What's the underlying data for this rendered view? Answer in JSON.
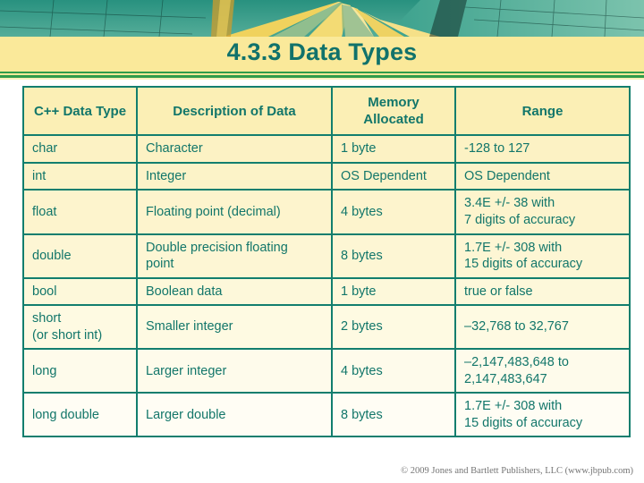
{
  "slide": {
    "title": "4.3.3 Data Types",
    "copyright": "© 2009 Jones and Bartlett Publishers, LLC (www.jbpub.com)"
  },
  "banner": {
    "name": "hot-air-balloon-photo",
    "colors": {
      "teal": "#2e9687",
      "teal_dark": "#1d7c6f",
      "teal_light": "#62b9a6",
      "yellow": "#f2d45c",
      "yellow_light": "#f7e79a",
      "gold": "#d9a22c",
      "shadow": "#13322c"
    }
  },
  "theme": {
    "title_color": "#11726b",
    "band_color": "#fae99a",
    "rule_color": "#2f9c4a",
    "table_border": "#127e6e",
    "table_text": "#12766a",
    "table_fill": "#fdf6d2"
  },
  "table": {
    "headers": [
      "C++\nData Type",
      "Description of Data",
      "Memory\nAllocated",
      "Range"
    ],
    "headers_lines": [
      [
        "C++",
        "Data Type"
      ],
      [
        "Description of Data"
      ],
      [
        "Memory",
        "Allocated"
      ],
      [
        "Range"
      ]
    ],
    "rows": [
      {
        "type": [
          "char"
        ],
        "description": [
          "Character"
        ],
        "memory": [
          "1 byte"
        ],
        "range": [
          "-128 to 127"
        ]
      },
      {
        "type": [
          "int"
        ],
        "description": [
          "Integer"
        ],
        "memory": [
          "OS Dependent"
        ],
        "range": [
          "OS Dependent"
        ]
      },
      {
        "type": [
          "float"
        ],
        "description": [
          "Floating point (decimal)"
        ],
        "memory": [
          "4 bytes"
        ],
        "range": [
          "3.4E +/- 38  with",
          "7 digits of accuracy"
        ]
      },
      {
        "type": [
          "double"
        ],
        "description": [
          "Double precision floating",
          "point"
        ],
        "memory": [
          "8 bytes"
        ],
        "range": [
          "1.7E +/- 308 with",
          "15 digits of accuracy"
        ]
      },
      {
        "type": [
          "bool"
        ],
        "description": [
          "Boolean data"
        ],
        "memory": [
          "1 byte"
        ],
        "range": [
          "true or false"
        ]
      },
      {
        "type": [
          "short",
          "(or short int)"
        ],
        "description": [
          "Smaller integer"
        ],
        "memory": [
          "2 bytes"
        ],
        "range": [
          "–32,768 to 32,767"
        ]
      },
      {
        "type": [
          "long"
        ],
        "description": [
          "Larger integer"
        ],
        "memory": [
          "4 bytes"
        ],
        "range": [
          "–2,147,483,648 to",
          "2,147,483,647"
        ]
      },
      {
        "type": [
          "long double"
        ],
        "description": [
          "Larger double"
        ],
        "memory": [
          "8 bytes"
        ],
        "range": [
          "1.7E +/- 308 with",
          "15 digits of accuracy"
        ]
      }
    ]
  }
}
